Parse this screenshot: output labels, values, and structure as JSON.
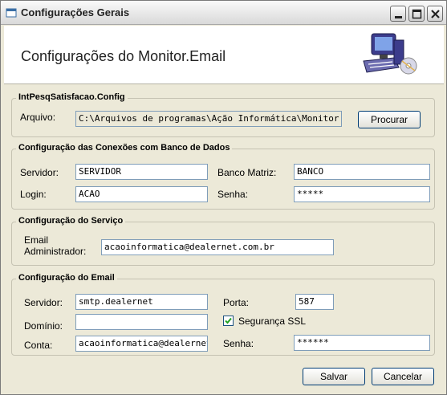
{
  "window": {
    "title": "Configurações Gerais",
    "header_title": "Configurações do Monitor.Email"
  },
  "config_group": {
    "legend": "IntPesqSatisfacao.Config",
    "arquivo_label": "Arquivo:",
    "arquivo_value": "C:\\Arquivos de programas\\Ação Informática\\Monitor.Em",
    "browse_button": "Procurar"
  },
  "db_group": {
    "legend": "Configuração das Conexões com Banco de Dados",
    "servidor_label": "Servidor:",
    "servidor_value": "SERVIDOR",
    "banco_label": "Banco Matriz:",
    "banco_value": "BANCO",
    "login_label": "Login:",
    "login_value": "ACAO",
    "senha_label": "Senha:",
    "senha_value": "*****"
  },
  "service_group": {
    "legend": "Configuração do Serviço",
    "email_admin_label_1": "Email",
    "email_admin_label_2": "Administrador:",
    "email_admin_value": "acaoinformatica@dealernet.com.br"
  },
  "email_group": {
    "legend": "Configuração do Email",
    "servidor_label": "Servidor:",
    "servidor_value": "smtp.dealernet",
    "porta_label": "Porta:",
    "porta_value": "587",
    "dominio_label": "Domínio:",
    "dominio_value": "",
    "ssl_label": "Segurança SSL",
    "ssl_checked": true,
    "conta_label": "Conta:",
    "conta_value": "acaoinformatica@dealernet.c",
    "senha_label": "Senha:",
    "senha_value": "******"
  },
  "footer": {
    "save_button": "Salvar",
    "cancel_button": "Cancelar"
  },
  "icons": {
    "app": "app-window-icon",
    "minimize": "minimize-icon",
    "maximize": "maximize-icon",
    "close": "close-icon",
    "header": "computer-icon",
    "checkbox": "checkmark-icon"
  }
}
